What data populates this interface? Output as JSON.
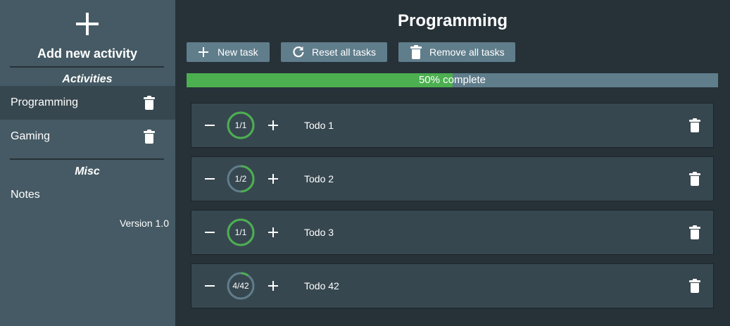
{
  "sidebar": {
    "add_label": "Add new activity",
    "activities_title": "Activities",
    "activities": [
      {
        "name": "Programming",
        "active": true
      },
      {
        "name": "Gaming",
        "active": false
      }
    ],
    "misc_title": "Misc",
    "notes_label": "Notes",
    "version": "Version 1.0"
  },
  "main": {
    "title": "Programming",
    "toolbar": {
      "new_task": "New task",
      "reset_all": "Reset all tasks",
      "remove_all": "Remove all tasks"
    },
    "progress": {
      "percent": 50,
      "label": "50% complete"
    },
    "tasks": [
      {
        "name": "Todo 1",
        "done": 1,
        "total": 1,
        "count_label": "1/1"
      },
      {
        "name": "Todo 2",
        "done": 1,
        "total": 2,
        "count_label": "1/2"
      },
      {
        "name": "Todo 3",
        "done": 1,
        "total": 1,
        "count_label": "1/1"
      },
      {
        "name": "Todo 42",
        "done": 4,
        "total": 42,
        "count_label": "4/42"
      }
    ]
  },
  "colors": {
    "sidebar_bg": "#455a64",
    "main_bg": "#263238",
    "card_bg": "#37474f",
    "button_bg": "#607d8b",
    "accent_green": "#4caf50",
    "ring_track": "#607d8b"
  }
}
